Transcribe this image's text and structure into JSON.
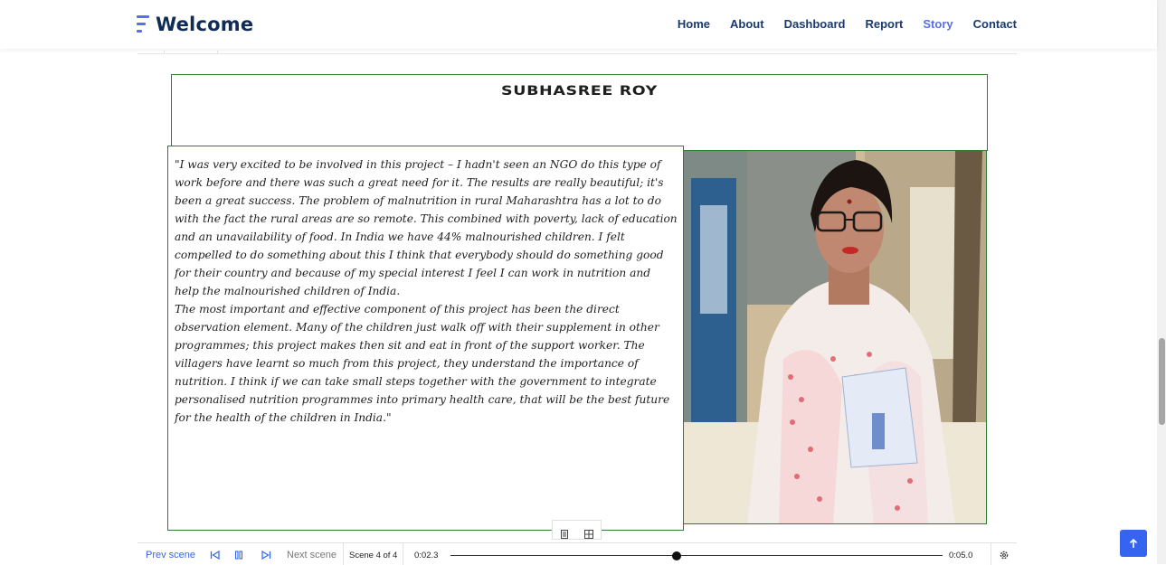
{
  "brand": {
    "name": "Welcome",
    "accent": "#5a6fe0",
    "text_color": "#0f2b56"
  },
  "nav": {
    "items": [
      {
        "label": "Home"
      },
      {
        "label": "About"
      },
      {
        "label": "Dashboard"
      },
      {
        "label": "Report"
      },
      {
        "label": "Story",
        "active": true
      },
      {
        "label": "Contact"
      }
    ]
  },
  "story": {
    "name": "SUBHASREE ROY",
    "quote_p1": "\"I was very excited to be involved in this project – I hadn't seen an NGO do this type of work before and there was such a great need for it. The results are really beautiful; it's been a great success. The problem of malnutrition in rural Maharashtra has a lot to do with the fact the rural areas are so remote. This combined with poverty, lack of education and an unavailability of food. In India we have 44% malnourished children. I felt compelled to do something about this I think that everybody should do something good for their country and because of my special interest I feel I can work in nutrition and help the malnourished children of India.",
    "quote_p2": "The most important and effective component of this project has been the direct observation element. Many of the children just walk off with their supplement in other programmes; this project makes then sit and eat in front of the support worker. The villagers have learnt so much from this project, they understand the importance of nutrition. I think if we can take small steps together with the government to integrate personalised nutrition programmes into primary health care, that will be the best future for the health of the children in India.\""
  },
  "player": {
    "prev_label": "Prev scene",
    "next_label": "Next scene",
    "scene_label": "Scene 4 of 4",
    "current_time": "0:02.3",
    "total_time": "0:05.0",
    "progress": 0.46
  },
  "icons": {
    "prev": "skip-back-icon",
    "pause": "pause-icon",
    "next": "skip-forward-icon",
    "settings": "gear-icon",
    "scroll_top": "arrow-up-icon"
  }
}
